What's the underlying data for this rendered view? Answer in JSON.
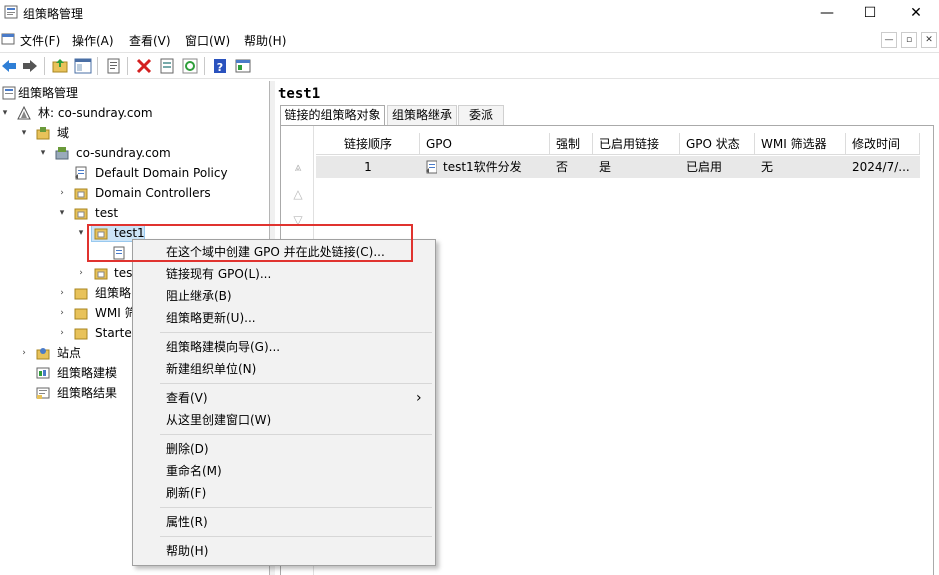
{
  "window": {
    "title": "组策略管理",
    "minimize": "—",
    "maximize": "☐",
    "close": "✕"
  },
  "menubar": [
    "文件(F)",
    "操作(A)",
    "查看(V)",
    "窗口(W)",
    "帮助(H)"
  ],
  "mdi": {
    "minimize": "—",
    "restore": "▫",
    "close": "✕"
  },
  "toolbar": {
    "icons": [
      "back-icon",
      "forward-icon",
      "folder-up-icon",
      "show-hide-tree-icon",
      "properties-icon",
      "delete-icon",
      "export-icon",
      "refresh-icon",
      "help-icon",
      "console-icon"
    ]
  },
  "tree": {
    "root": "组策略管理",
    "forest": "林: co-sundray.com",
    "domains": "域",
    "domain": "co-sundray.com",
    "default_policy": "Default Domain Policy",
    "domain_controllers": "Domain Controllers",
    "test": "test",
    "test1": "test1",
    "test1_child": "",
    "test_sibling": "tes",
    "gpo_objects": "组策略",
    "wmi": "WMI 筛",
    "starter": "Starter",
    "sites": "站点",
    "modeling": "组策略建模",
    "results": "组策略结果"
  },
  "right": {
    "title": "test1",
    "tabs": [
      "链接的组策略对象",
      "组策略继承",
      "委派"
    ],
    "columns": [
      "链接顺序",
      "GPO",
      "强制",
      "已启用链接",
      "GPO 状态",
      "WMI 筛选器",
      "修改时间"
    ],
    "rows": [
      {
        "order": "1",
        "gpo": "test1软件分发",
        "enforced": "否",
        "link_enabled": "是",
        "status": "已启用",
        "wmi": "无",
        "modified": "2024/7/..."
      }
    ]
  },
  "context_menu": {
    "groups": [
      [
        "在这个域中创建 GPO 并在此处链接(C)...",
        "链接现有 GPO(L)...",
        "阻止继承(B)",
        "组策略更新(U)..."
      ],
      [
        "组策略建模向导(G)...",
        "新建组织单位(N)"
      ],
      [
        "查看(V)",
        "从这里创建窗口(W)"
      ],
      [
        "删除(D)",
        "重命名(M)",
        "刷新(F)"
      ],
      [
        "属性(R)"
      ],
      [
        "帮助(H)"
      ]
    ],
    "submenu_arrow": "›"
  },
  "colors": {
    "highlight_box": "#e0332f",
    "menu_bg": "#f2f2f2",
    "selected_row": "#e8e8e8"
  }
}
